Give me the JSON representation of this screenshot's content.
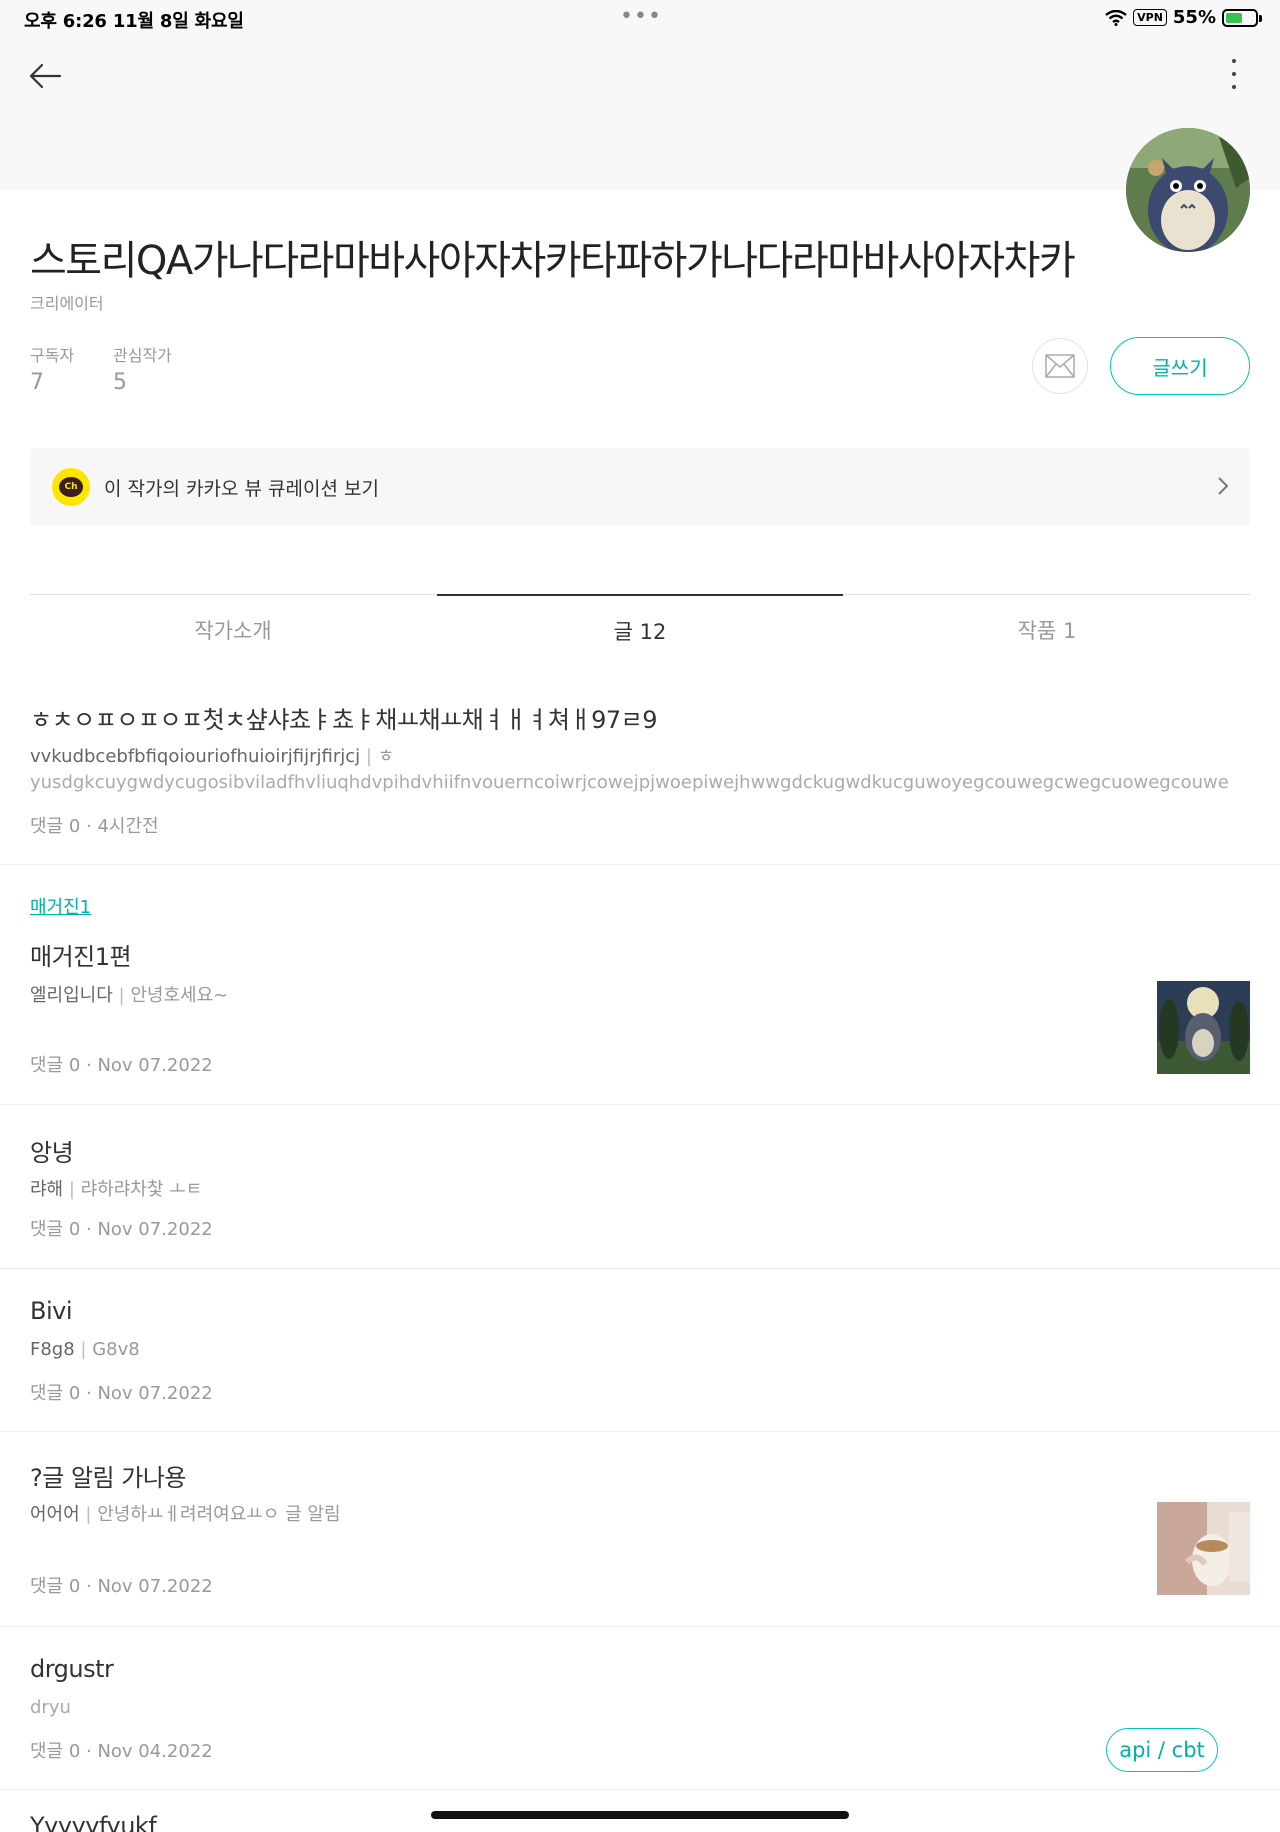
{
  "status_bar": {
    "time": "오후 6:26   11월 8일 화요일",
    "vpn": "VPN",
    "battery": "55%"
  },
  "profile": {
    "title": "스토리QA가나다라마바사아자차카타파하가나다라마바사아자차카",
    "role": "크리에이터",
    "subscribers_label": "구독자",
    "subscribers_value": "7",
    "following_label": "관심작가",
    "following_value": "5",
    "write_label": "글쓰기"
  },
  "kakao": {
    "badge": "Ch",
    "label": "이 작가의 카카오 뷰 큐레이션 보기"
  },
  "tabs": [
    {
      "label": "작가소개"
    },
    {
      "label": "글 12"
    },
    {
      "label": "작품 1"
    }
  ],
  "posts": [
    {
      "title": "ㅎㅊㅇㅍㅇㅍㅇㅍ첫ㅊ샾샤쵸ㅑ쵸ㅑ채ㅛ채ㅛ채ㅕㅐㅕ쳐ㅐ97ㄹ9",
      "subtitle": "vvkudbcebfbfiqoiouriofhuioirjfijrjfirjcj",
      "desc": "ㅎ",
      "desc2": "yusdgkcuygwdycugosibviladfhvliuqhdvpihdvhiifnvouerncoiwrjcowejpjwoepiwejhwwgdckugwdkucguwoyegcouwegcwegcuowegcouwe",
      "meta": "댓글 0 · 4시간전"
    },
    {
      "magazine": "매거진1",
      "title": "매거진1편",
      "subtitle": "엘리입니다",
      "desc": "안녕호세요~",
      "meta": "댓글 0 · Nov 07.2022"
    },
    {
      "title": "앙녕",
      "subtitle": "랴해",
      "desc": "랴하랴차찿 ㅗㅌ",
      "meta": "댓글 0 · Nov 07.2022"
    },
    {
      "title": "Bivi",
      "subtitle": "F8g8",
      "desc": "G8v8",
      "meta": "댓글 0 · Nov 07.2022"
    },
    {
      "title": "?글 알림 가나용",
      "subtitle": "어어어",
      "desc": "안녕하ㅛㅔ려려여요ㅛㅇ 글 알림",
      "meta": "댓글 0 · Nov 07.2022"
    },
    {
      "title": "drgustr",
      "subtitle": "",
      "desc": "dryu",
      "meta": "댓글 0 · Nov 04.2022",
      "tag": "api / cbt"
    },
    {
      "title": "Yyyyyfyukf"
    }
  ],
  "colors": {
    "accent": "#00c3bd",
    "kakao_yellow": "#fee500",
    "header_bg": "#f8f8f8"
  }
}
